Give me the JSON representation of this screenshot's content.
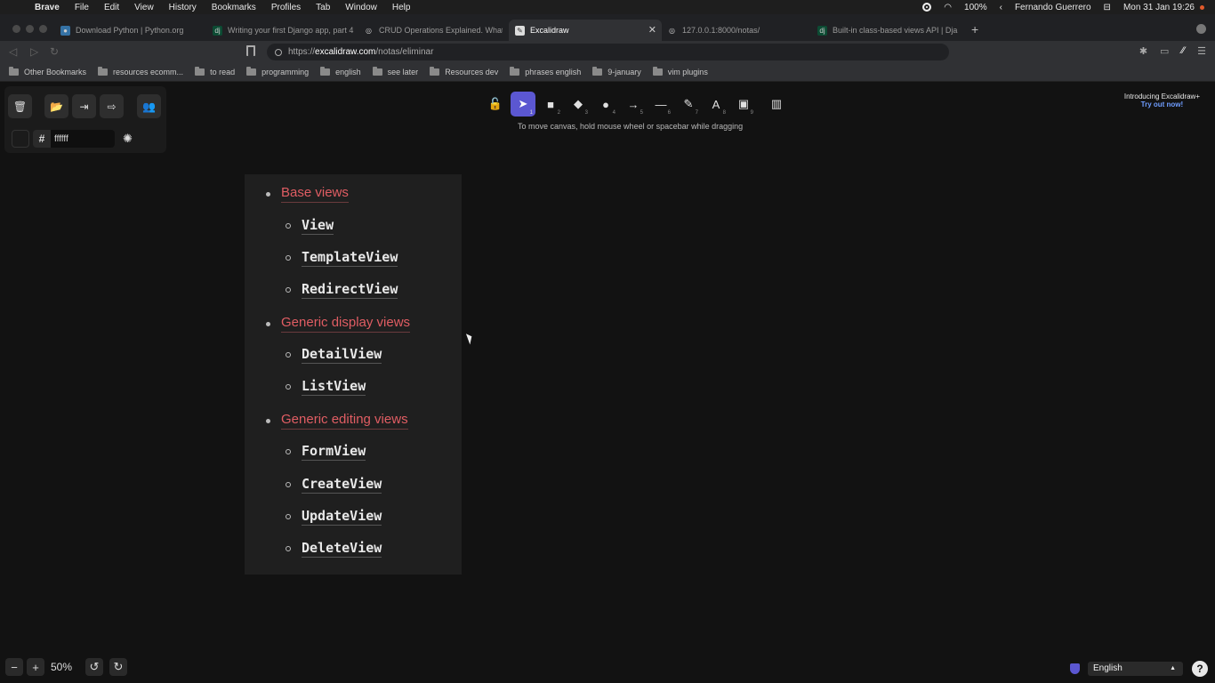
{
  "menubar": {
    "apple": "",
    "items": [
      "Brave",
      "File",
      "Edit",
      "View",
      "History",
      "Bookmarks",
      "Profiles",
      "Tab",
      "Window",
      "Help"
    ],
    "battery": "100%",
    "user": "Fernando Guerrero",
    "datetime": "Mon 31 Jan  19:26"
  },
  "tabs": [
    {
      "title": "Download Python | Python.org",
      "icon": "python-icon"
    },
    {
      "title": "Writing your first Django app, part 4",
      "icon": "django-icon"
    },
    {
      "title": "CRUD Operations Explained. What i",
      "icon": "globe-icon"
    },
    {
      "title": "Excalidraw",
      "icon": "excalidraw-icon",
      "active": true
    },
    {
      "title": "127.0.0.1:8000/notas/",
      "icon": "globe-icon"
    },
    {
      "title": "Built-in class-based views API | Dja",
      "icon": "django-icon"
    }
  ],
  "address": {
    "prefix": "https://",
    "domain": "excalidraw.com",
    "path": "/notas/eliminar"
  },
  "bookmarks": [
    "Other Bookmarks",
    "resources ecomm...",
    "to read",
    "programming",
    "english",
    "see later",
    "Resources dev",
    "phrases english",
    "9-january",
    "vim plugins"
  ],
  "excalidraw": {
    "color_hash": "#",
    "color_value": "ffffff",
    "hint": "To move canvas, hold mouse wheel or spacebar while dragging",
    "promo_line1": "Introducing Excalidraw+",
    "promo_line2": "Try out now!",
    "tools": [
      {
        "name": "lock-icon",
        "glyph": "🔓",
        "num": ""
      },
      {
        "name": "selection-icon",
        "glyph": "➤",
        "num": "1",
        "active": true
      },
      {
        "name": "rectangle-icon",
        "glyph": "■",
        "num": "2"
      },
      {
        "name": "diamond-icon",
        "glyph": "◆",
        "num": "3"
      },
      {
        "name": "ellipse-icon",
        "glyph": "●",
        "num": "4"
      },
      {
        "name": "arrow-icon",
        "glyph": "→",
        "num": "5"
      },
      {
        "name": "line-icon",
        "glyph": "—",
        "num": "6"
      },
      {
        "name": "pencil-icon",
        "glyph": "✎",
        "num": "7"
      },
      {
        "name": "text-icon",
        "glyph": "A",
        "num": "8"
      },
      {
        "name": "image-icon",
        "glyph": "▣",
        "num": "9"
      },
      {
        "name": "library-icon",
        "glyph": "▥",
        "num": ""
      }
    ],
    "zoom": "50%",
    "language": "English"
  },
  "content": {
    "sections": [
      {
        "title": "Base views",
        "items": [
          "View",
          "TemplateView",
          "RedirectView"
        ]
      },
      {
        "title": "Generic display views",
        "items": [
          "DetailView",
          "ListView"
        ]
      },
      {
        "title": "Generic editing views",
        "items": [
          "FormView",
          "CreateView",
          "UpdateView",
          "DeleteView"
        ]
      }
    ]
  }
}
